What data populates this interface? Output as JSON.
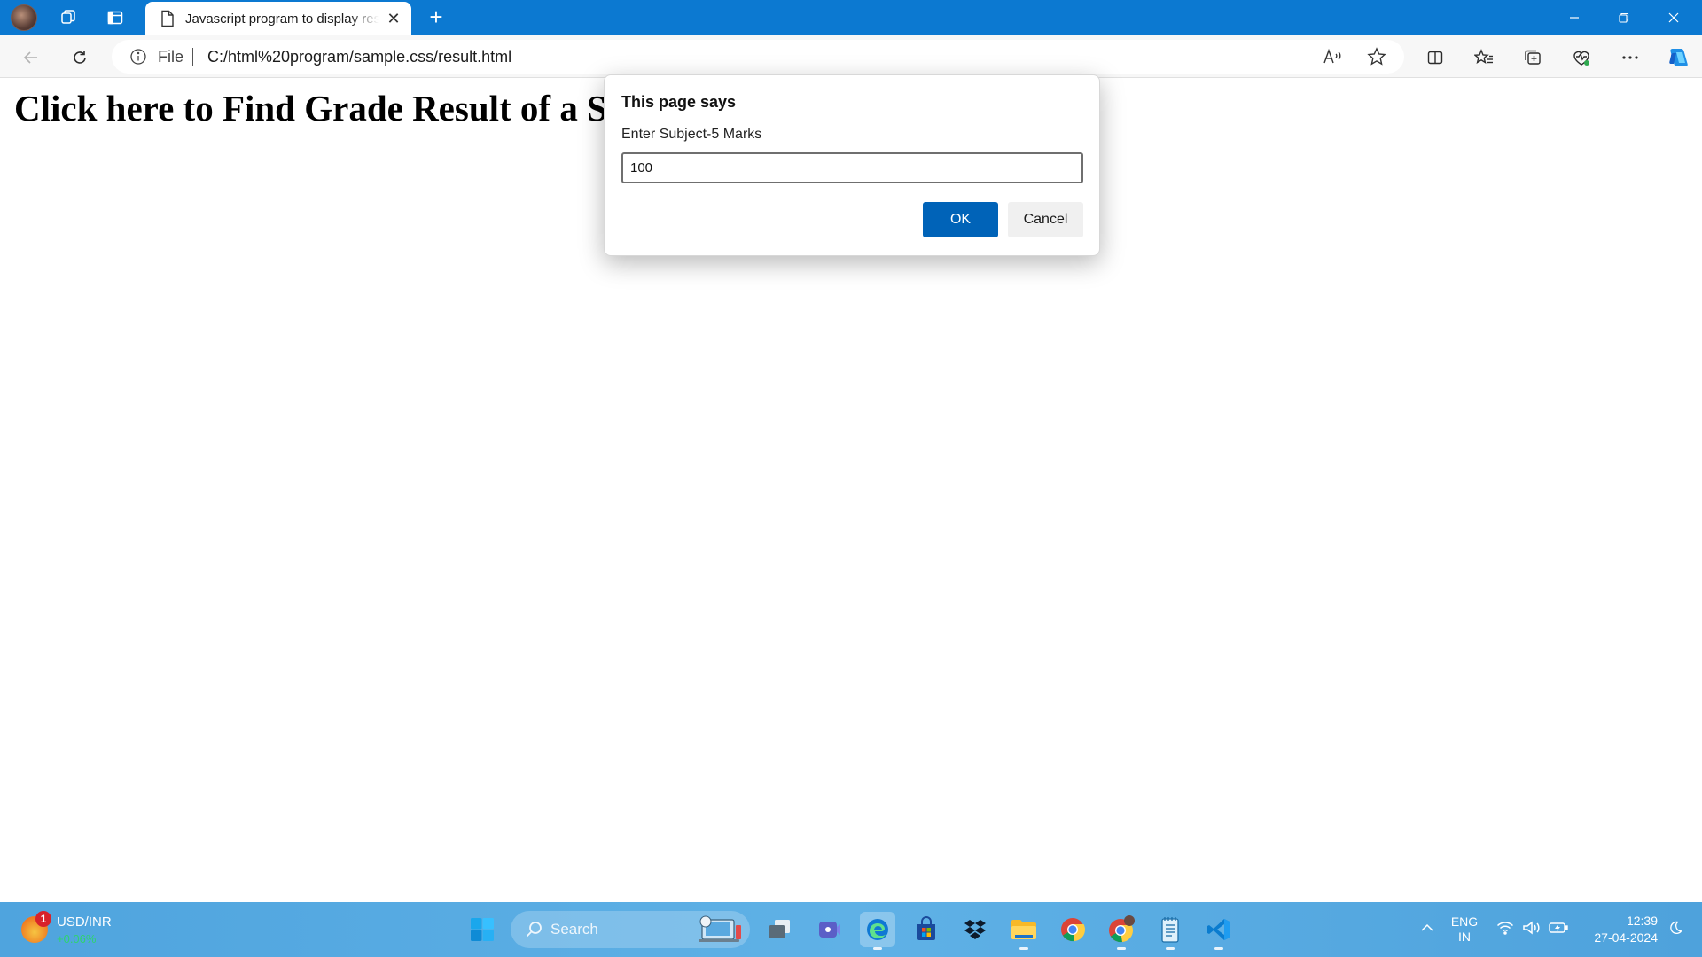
{
  "browser": {
    "tab_title": "Javascript program to display result",
    "file_label": "File",
    "url": "C:/html%20program/sample.css/result.html"
  },
  "page": {
    "heading": "Click here to Find Grade Result of a Student"
  },
  "dialog": {
    "title": "This page says",
    "message": "Enter Subject-5 Marks",
    "input_value": "100",
    "ok_label": "OK",
    "cancel_label": "Cancel"
  },
  "taskbar": {
    "widget_label": "USD/INR",
    "widget_value": "+0.06%",
    "widget_badge": "1",
    "search_label": "Search",
    "language_top": "ENG",
    "language_bottom": "IN",
    "time": "12:39",
    "date": "27-04-2024",
    "apps": [
      "start-icon",
      "task-view-icon",
      "teams-icon",
      "edge-icon",
      "store-icon",
      "dropbox-icon",
      "file-explorer-icon",
      "chrome-icon",
      "chrome-profile-icon",
      "notepad-icon",
      "vscode-icon"
    ]
  },
  "colors": {
    "titlebar": "#0c79d1",
    "ok_button": "#0063b8",
    "taskbar": "#5fb1e6"
  }
}
